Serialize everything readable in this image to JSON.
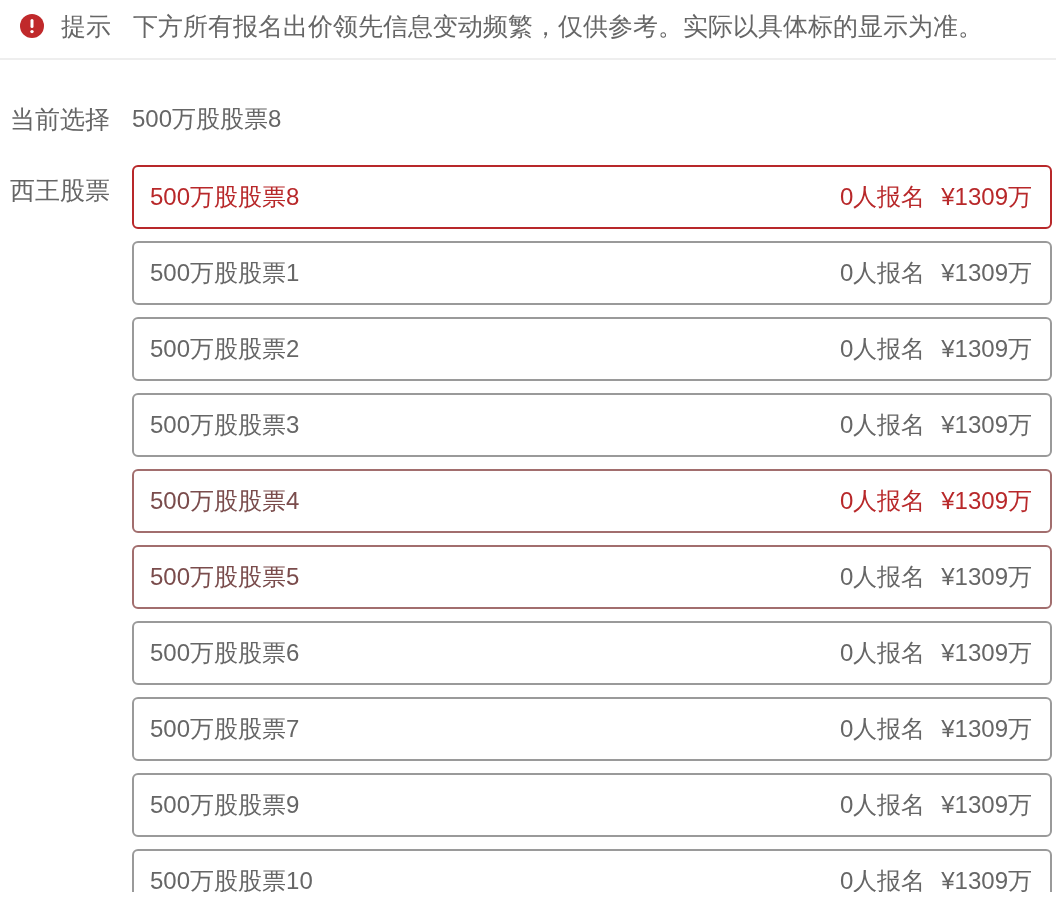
{
  "notice": {
    "label": "提示",
    "text": "下方所有报名出价领先信息变动频繁，仅供参考。实际以具体标的显示为准。"
  },
  "current": {
    "label": "当前选择",
    "value": "500万股股票8"
  },
  "group": {
    "label": "西王股票",
    "options": [
      {
        "name": "500万股股票8",
        "signups": "0人报名",
        "price": "¥1309万",
        "selected": true,
        "hovered": false,
        "leading": true
      },
      {
        "name": "500万股股票1",
        "signups": "0人报名",
        "price": "¥1309万",
        "selected": false,
        "hovered": false,
        "leading": false
      },
      {
        "name": "500万股股票2",
        "signups": "0人报名",
        "price": "¥1309万",
        "selected": false,
        "hovered": false,
        "leading": false
      },
      {
        "name": "500万股股票3",
        "signups": "0人报名",
        "price": "¥1309万",
        "selected": false,
        "hovered": false,
        "leading": false
      },
      {
        "name": "500万股股票4",
        "signups": "0人报名",
        "price": "¥1309万",
        "selected": false,
        "hovered": true,
        "leading": true
      },
      {
        "name": "500万股股票5",
        "signups": "0人报名",
        "price": "¥1309万",
        "selected": false,
        "hovered": true,
        "leading": false
      },
      {
        "name": "500万股股票6",
        "signups": "0人报名",
        "price": "¥1309万",
        "selected": false,
        "hovered": false,
        "leading": false
      },
      {
        "name": "500万股股票7",
        "signups": "0人报名",
        "price": "¥1309万",
        "selected": false,
        "hovered": false,
        "leading": false
      },
      {
        "name": "500万股股票9",
        "signups": "0人报名",
        "price": "¥1309万",
        "selected": false,
        "hovered": false,
        "leading": false
      },
      {
        "name": "500万股股票10",
        "signups": "0人报名",
        "price": "¥1309万",
        "selected": false,
        "hovered": false,
        "leading": false
      }
    ]
  }
}
